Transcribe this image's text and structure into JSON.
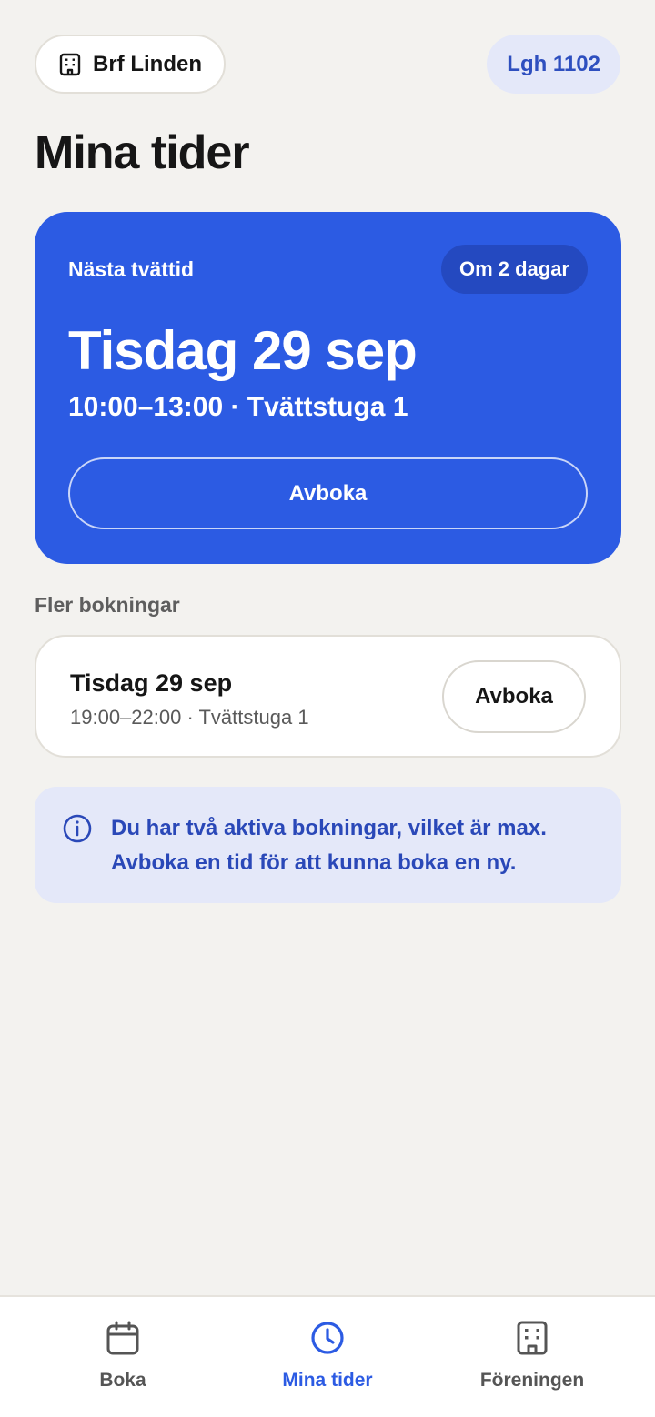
{
  "header": {
    "org_icon": "building-icon",
    "org_name": "Brf Linden",
    "apartment": "Lgh 1102"
  },
  "page_title": "Mina tider",
  "next_booking": {
    "eyebrow": "Nästa tvättid",
    "badge": "Om 2 dagar",
    "date": "Tisdag 29 sep",
    "time_and_room": "10:00–13:00 · Tvättstuga 1",
    "cancel_label": "Avboka"
  },
  "more_bookings": {
    "section_label": "Fler bokningar",
    "items": [
      {
        "date": "Tisdag 29 sep",
        "meta": "19:00–22:00 · Tvättstuga 1",
        "cancel_label": "Avboka"
      }
    ]
  },
  "info": {
    "icon": "info-icon",
    "text": "Du har två aktiva bokningar, vilket är max. Avboka en tid för att kunna boka en ny."
  },
  "nav": {
    "items": [
      {
        "label": "Boka",
        "icon": "calendar-icon",
        "active": false
      },
      {
        "label": "Mina tider",
        "icon": "clock-icon",
        "active": true
      },
      {
        "label": "Föreningen",
        "icon": "building-icon",
        "active": false
      }
    ]
  },
  "colors": {
    "background": "#f3f2ef",
    "primary": "#2c5be3",
    "primary_dark": "#2449c0",
    "info_bg": "#e4e8f9",
    "info_text": "#2a48b8"
  }
}
